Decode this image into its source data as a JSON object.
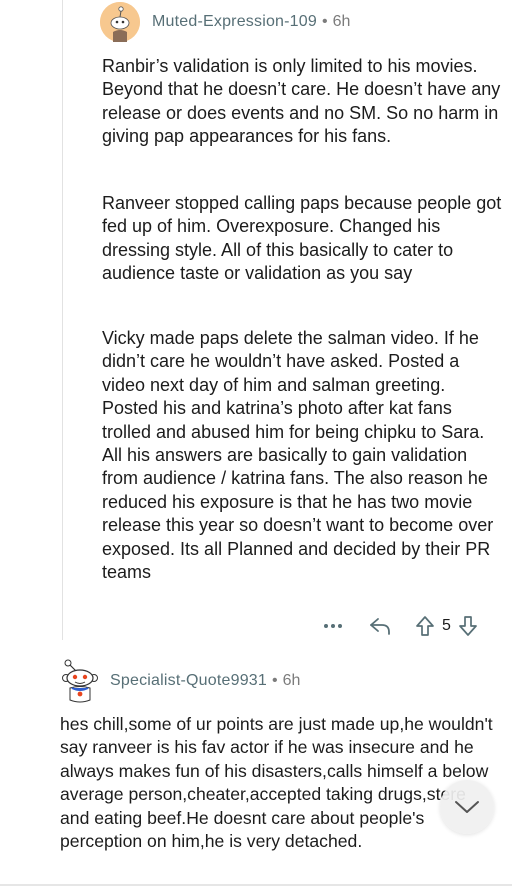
{
  "comment1": {
    "username": "Muted-Expression-109",
    "separator": "•",
    "time": "6h",
    "paragraphs": [
      "Ranbir’s validation is only limited to his movies. Beyond that he doesn’t care. He doesn’t have any release or does events and no SM. So no harm in giving pap appearances for his fans.",
      "Ranveer stopped calling paps because people got fed up of him. Overexposure. Changed his dressing style. All of this basically to cater to audience taste or validation as you say",
      "Vicky made paps delete the salman video. If he didn’t care he wouldn’t have asked. Posted a video next day of him and salman greeting. Posted his and katrina’s photo after kat fans trolled and abused him for being chipku to Sara. All his answers are basically to gain validation from audience / katrina fans. The also reason he reduced his exposure is that he has two movie release this year so doesn’t want to become over exposed. Its all Planned and decided by their PR teams"
    ],
    "score": "5"
  },
  "comment2": {
    "username": "Specialist-Quote9931",
    "separator": "•",
    "time": "6h",
    "body": "hes chill,some of ur points are just made up,he wouldn't say ranveer is his fav actor if he was insecure and he always makes fun of his disasters,calls himself a below average person,cheater,accepted taking drugs,stere and eating beef.He doesnt care about people's perception on him,he is very detached."
  },
  "icons": {
    "more": "more-dots-icon",
    "reply": "reply-arrow-icon",
    "upvote": "upvote-arrow-icon",
    "downvote": "downvote-arrow-icon",
    "scroll": "chevron-down-icon"
  },
  "colors": {
    "avatar_orange": "#f7c88f",
    "meta_text": "#7c7c7c",
    "thread_line": "#e2e2e2"
  }
}
